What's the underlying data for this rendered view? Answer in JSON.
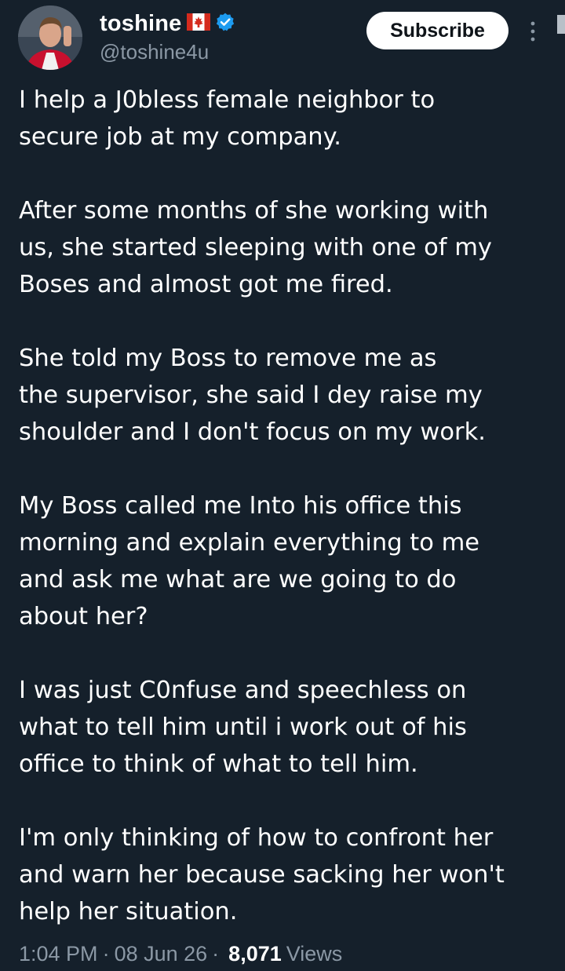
{
  "author": {
    "display_name": "toshine",
    "handle": "@toshine4u",
    "flag_icon": "canada-flag-icon",
    "verified_icon": "verified-badge-icon",
    "verified_color": "#1d9bf0"
  },
  "actions": {
    "subscribe_label": "Subscribe",
    "more_icon": "more-vertical-icon"
  },
  "tweet": {
    "paragraphs": [
      "I help a J0bless female neighbor to\nsecure job at my company.",
      "After some months of she working with\nus, she started sleeping with one of my\nBoses and almost got me fired.",
      "She told my Boss to remove me as\nthe supervisor, she said I dey raise my\nshoulder and I don't focus on my work.",
      "My Boss called me Into his office this\nmorning and explain everything to me\nand ask me what are we going to do\nabout her?",
      "I was just C0nfuse and speechless on\nwhat to tell him until i work out of his\noffice to think of what to tell him.",
      "I'm only thinking of how to confront her\nand warn her because sacking her won't\nhelp her situation."
    ]
  },
  "meta": {
    "time": "1:04 PM",
    "date": "08 Jun 26",
    "separator": "·",
    "views_count": "8,071",
    "views_label": "Views"
  },
  "colors": {
    "background": "#15202b",
    "text_primary": "#ffffff",
    "text_secondary": "#8b98a5",
    "button_bg": "#ffffff",
    "button_text": "#0f1419"
  }
}
